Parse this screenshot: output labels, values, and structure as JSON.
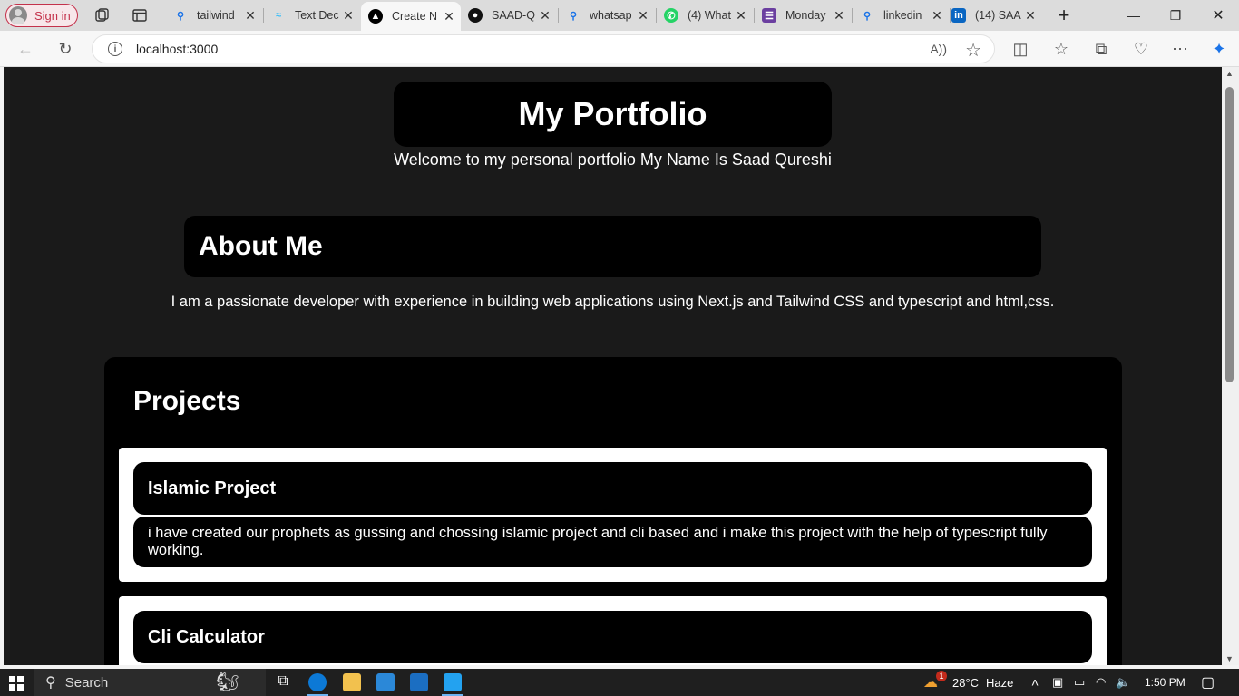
{
  "browser": {
    "signin_label": "Sign in",
    "tabs": [
      {
        "title": "tailwind",
        "icon": "search-icon"
      },
      {
        "title": "Text Dec",
        "icon": "tailwind-icon"
      },
      {
        "title": "Create N",
        "icon": "nextjs-icon"
      },
      {
        "title": "SAAD-Q",
        "icon": "github-icon"
      },
      {
        "title": "whatsap",
        "icon": "search-icon"
      },
      {
        "title": "(4) What",
        "icon": "whatsapp-icon"
      },
      {
        "title": "Monday",
        "icon": "forms-icon"
      },
      {
        "title": "linkedin",
        "icon": "search-icon"
      },
      {
        "title": "(14) SAA",
        "icon": "linkedin-icon"
      }
    ],
    "url": "localhost:3000"
  },
  "page": {
    "hero_title": "My Portfolio",
    "hero_subtitle": "Welcome to my personal portfolio My Name Is Saad Qureshi",
    "about_title": "About Me",
    "about_text": "I am a passionate developer with experience in building web applications using Next.js and Tailwind CSS and typescript and html,css.",
    "projects_title": "Projects",
    "projects": [
      {
        "title": "Islamic Project",
        "description": "i have created our prophets as gussing and chossing islamic project and cli based and i make this project with the help of typescript fully working."
      },
      {
        "title": "Cli Calculator"
      }
    ]
  },
  "taskbar": {
    "search_label": "Search",
    "weather_temp": "28°C",
    "weather_desc": "Haze",
    "weather_badge": "1",
    "time": "1:50 PM"
  }
}
